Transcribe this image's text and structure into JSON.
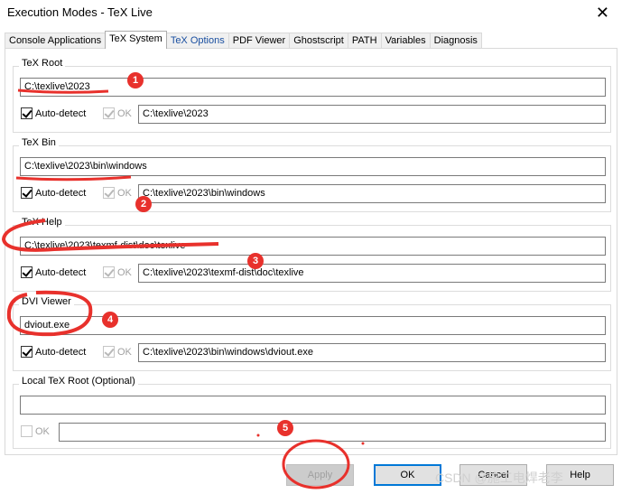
{
  "window": {
    "title": "Execution Modes - TeX Live",
    "close_glyph": "✕"
  },
  "tabs": [
    {
      "label": "Console Applications"
    },
    {
      "label": "TeX System"
    },
    {
      "label": "TeX Options"
    },
    {
      "label": "PDF Viewer"
    },
    {
      "label": "Ghostscript"
    },
    {
      "label": "PATH"
    },
    {
      "label": "Variables"
    },
    {
      "label": "Diagnosis"
    }
  ],
  "groups": {
    "tex_root": {
      "label": "TeX Root",
      "value": "C:\\texlive\\2023",
      "autodetect_label": "Auto-detect",
      "ok_label": "OK",
      "detected": "C:\\texlive\\2023"
    },
    "tex_bin": {
      "label": "TeX Bin",
      "value": "C:\\texlive\\2023\\bin\\windows",
      "autodetect_label": "Auto-detect",
      "ok_label": "OK",
      "detected": "C:\\texlive\\2023\\bin\\windows"
    },
    "tex_help": {
      "label": "TeX Help",
      "value": "C:\\texlive\\2023\\texmf-dist\\doc\\texlive",
      "autodetect_label": "Auto-detect",
      "ok_label": "OK",
      "detected": "C:\\texlive\\2023\\texmf-dist\\doc\\texlive"
    },
    "dvi_viewer": {
      "label": "DVI Viewer",
      "value": "dviout.exe",
      "autodetect_label": "Auto-detect",
      "ok_label": "OK",
      "detected": "C:\\texlive\\2023\\bin\\windows\\dviout.exe"
    },
    "local_root": {
      "label": "Local TeX Root (Optional)",
      "value": "",
      "ok_label": "OK",
      "detected": ""
    }
  },
  "buttons": {
    "apply": "Apply",
    "ok": "OK",
    "cancel": "Cancel",
    "help": "Help"
  },
  "annotations": {
    "badges": [
      "1",
      "2",
      "3",
      "4",
      "5"
    ],
    "color": "#e8312c"
  },
  "watermark": "CSDN @施工电焊老李"
}
